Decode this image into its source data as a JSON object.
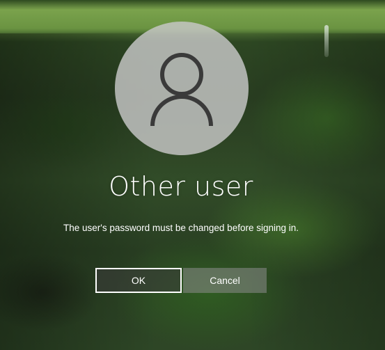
{
  "user": {
    "name": "Other user",
    "avatar_icon": "user-silhouette-icon"
  },
  "dialog": {
    "message": "The user's password must be changed before signing in.",
    "ok_label": "OK",
    "cancel_label": "Cancel"
  },
  "colors": {
    "avatar_circle": "#c8c8c8",
    "avatar_glyph": "#3a3a3a",
    "text": "#ffffff"
  }
}
